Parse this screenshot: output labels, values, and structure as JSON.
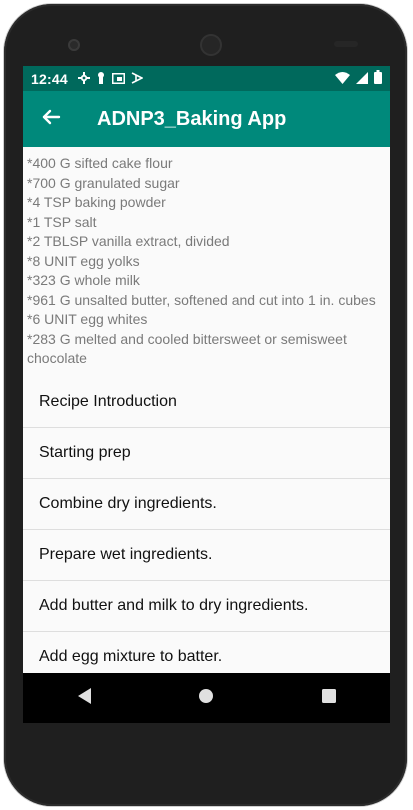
{
  "status_bar": {
    "time": "12:44",
    "left_icons": [
      "settings-icon",
      "person-icon",
      "cast-icon",
      "download-icon"
    ],
    "right_icons": [
      "wifi-icon",
      "cell-signal-icon",
      "battery-icon"
    ]
  },
  "app_bar": {
    "title": "ADNP3_Baking App",
    "back_icon": "arrow-left-icon"
  },
  "ingredients": [
    "*400 G sifted cake flour",
    "*700 G granulated sugar",
    "*4 TSP baking powder",
    "*1 TSP salt",
    "*2 TBLSP vanilla extract, divided",
    "*8 UNIT egg yolks",
    "*323 G whole milk",
    "*961 G unsalted butter, softened and cut into 1 in. cubes",
    "*6 UNIT egg whites",
    "*283 G melted and cooled bittersweet or semisweet chocolate"
  ],
  "steps": [
    "Recipe Introduction",
    "Starting prep",
    "Combine dry ingredients.",
    "Prepare wet ingredients.",
    "Add butter and milk to dry ingredients.",
    "Add egg mixture to batter."
  ],
  "nav_bar": {
    "buttons": [
      "back-triangle-icon",
      "home-circle-icon",
      "recents-square-icon"
    ]
  },
  "colors": {
    "status_bar": "#00695c",
    "app_bar": "#00897b",
    "nav_bar": "#000000",
    "background": "#fafafa"
  }
}
